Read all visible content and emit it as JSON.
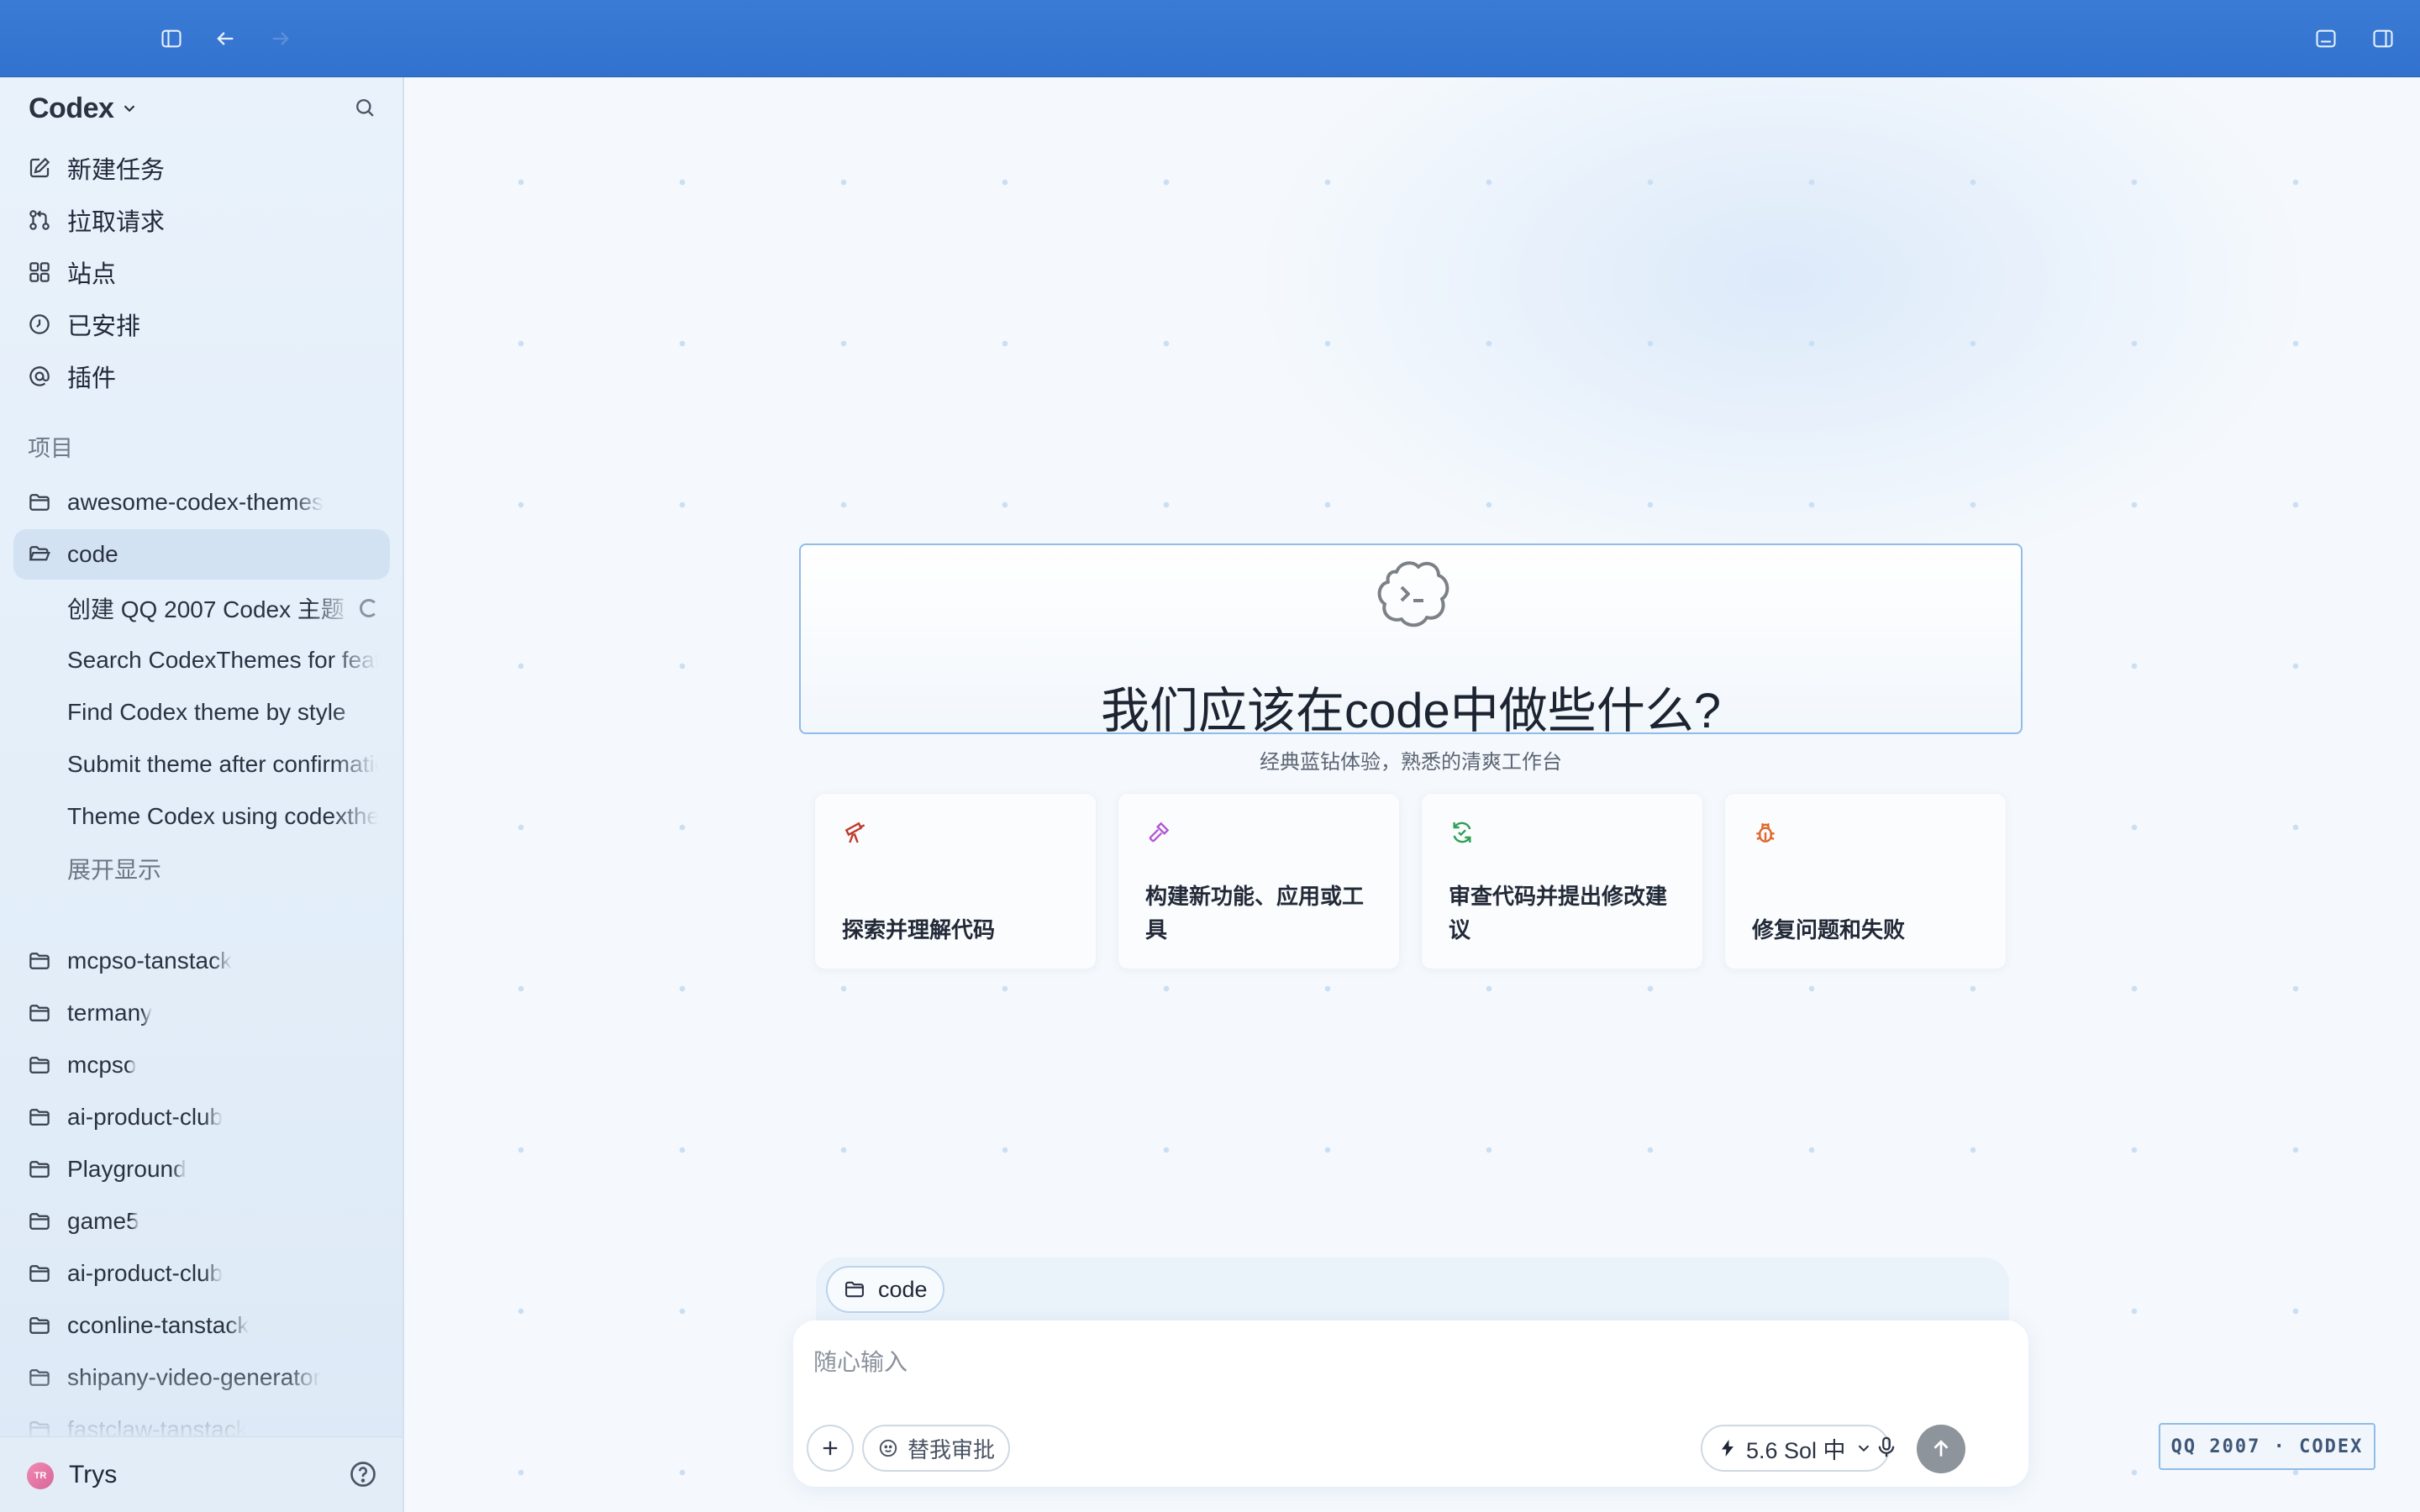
{
  "sidebar": {
    "title": "Codex",
    "nav": [
      {
        "label": "新建任务",
        "icon": "edit-icon"
      },
      {
        "label": "拉取请求",
        "icon": "pull-request-icon"
      },
      {
        "label": "站点",
        "icon": "grid-icon"
      },
      {
        "label": "已安排",
        "icon": "clock-icon"
      },
      {
        "label": "插件",
        "icon": "at-icon"
      }
    ],
    "section_label": "项目",
    "projects_top": [
      {
        "label": "awesome-codex-themes"
      },
      {
        "label": "code"
      }
    ],
    "tasks": [
      {
        "label": "创建 QQ 2007 Codex 主题"
      },
      {
        "label": "Search CodexThemes for feature"
      },
      {
        "label": "Find Codex theme by style"
      },
      {
        "label": "Submit theme after confirmation"
      },
      {
        "label": "Theme Codex using codexthemes"
      }
    ],
    "show_more": "展开显示",
    "projects": [
      {
        "label": "mcpso-tanstack"
      },
      {
        "label": "termany"
      },
      {
        "label": "mcpso"
      },
      {
        "label": "ai-product-club"
      },
      {
        "label": "Playground"
      },
      {
        "label": "game5"
      },
      {
        "label": "ai-product-club"
      },
      {
        "label": "cconline-tanstack"
      },
      {
        "label": "shipany-video-generator"
      },
      {
        "label": "fastclaw-tanstack"
      }
    ],
    "user": {
      "name": "Trys",
      "initials": "TR"
    }
  },
  "main": {
    "title": "我们应该在code中做些什么?",
    "subtitle": "经典蓝钻体验，熟悉的清爽工作台",
    "cards": [
      {
        "label": "探索并理解代码",
        "icon": "telescope-icon",
        "color": "#c0392b"
      },
      {
        "label": "构建新功能、应用或工具",
        "icon": "hammer-icon",
        "color": "#b455d6"
      },
      {
        "label": "审查代码并提出修改建议",
        "icon": "refresh-check-icon",
        "color": "#2fa055"
      },
      {
        "label": "修复问题和失败",
        "icon": "bug-icon",
        "color": "#e0662a"
      }
    ],
    "composer": {
      "chip": "code",
      "placeholder": "随心输入",
      "approve_label": "替我审批",
      "model_label": "5.6 Sol 中"
    },
    "badge": "QQ 2007 · CODEX"
  },
  "colors": {
    "topbar": "#3574d1",
    "accent_border": "#8fbce8",
    "sidebar_bg": "#e6f0fa"
  }
}
